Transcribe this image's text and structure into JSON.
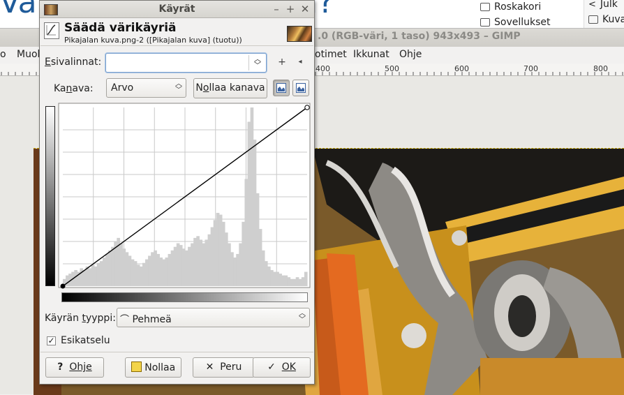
{
  "background": {
    "heading_left": "Va",
    "heading_right": "l?",
    "sidebar": [
      {
        "icon": "trash-icon",
        "label": "Roskakori"
      },
      {
        "icon": "apps-icon",
        "label": "Sovellukset"
      }
    ],
    "sidebar2": [
      {
        "icon": "share-icon",
        "label": "Julk"
      },
      {
        "icon": "camera-icon",
        "label": "Kuva"
      }
    ],
    "gimp_title": ".0 (RGB-väri, 1 taso) 943x493 – GIMP",
    "menu": {
      "left_cut": "o",
      "muok_cut": "Muok",
      "tyokalut_cut": "otimet",
      "ikkunat": "Ikkunat",
      "ohje": "Ohje"
    },
    "ruler_labels": [
      "400",
      "500",
      "600",
      "700",
      "800"
    ]
  },
  "dialog": {
    "window_title": "Käyrät",
    "header_title": "Säädä värikäyriä",
    "header_subtitle": "Pikajalan kuva.png-2 ([Pikajalan kuva] (tuotu))",
    "presets_label": "Esivalinnat:",
    "presets_value": "",
    "channel_label": "Kanava:",
    "channel_value": "Arvo",
    "reset_channel_label": "Nollaa kanava",
    "curve_type_label": "Käyrän tyyppi:",
    "curve_type_value": "Pehmeä",
    "preview_label": "Esikatselu",
    "preview_checked": true,
    "buttons": {
      "help": "Ohje",
      "reset": "Nollaa",
      "cancel": "Peru",
      "ok": "OK"
    }
  },
  "curve": {
    "points": [
      [
        0,
        0
      ],
      [
        255,
        255
      ]
    ],
    "histogram": [
      4,
      6,
      7,
      8,
      9,
      8,
      10,
      9,
      11,
      10,
      12,
      11,
      13,
      14,
      16,
      18,
      20,
      22,
      25,
      27,
      24,
      21,
      19,
      17,
      15,
      14,
      12,
      11,
      13,
      15,
      17,
      19,
      20,
      18,
      16,
      15,
      16,
      18,
      20,
      22,
      24,
      23,
      21,
      20,
      22,
      24,
      27,
      28,
      26,
      24,
      26,
      29,
      33,
      37,
      41,
      40,
      36,
      30,
      24,
      19,
      16,
      18,
      24,
      36,
      60,
      92,
      100,
      82,
      52,
      32,
      20,
      14,
      11,
      9,
      8,
      8,
      7,
      6,
      6,
      5,
      4,
      4,
      5,
      4,
      5,
      8
    ]
  },
  "colors": {
    "accent_blue": "#1f5b9a",
    "histogram": "#cfcfcf",
    "curve": "#000000"
  }
}
